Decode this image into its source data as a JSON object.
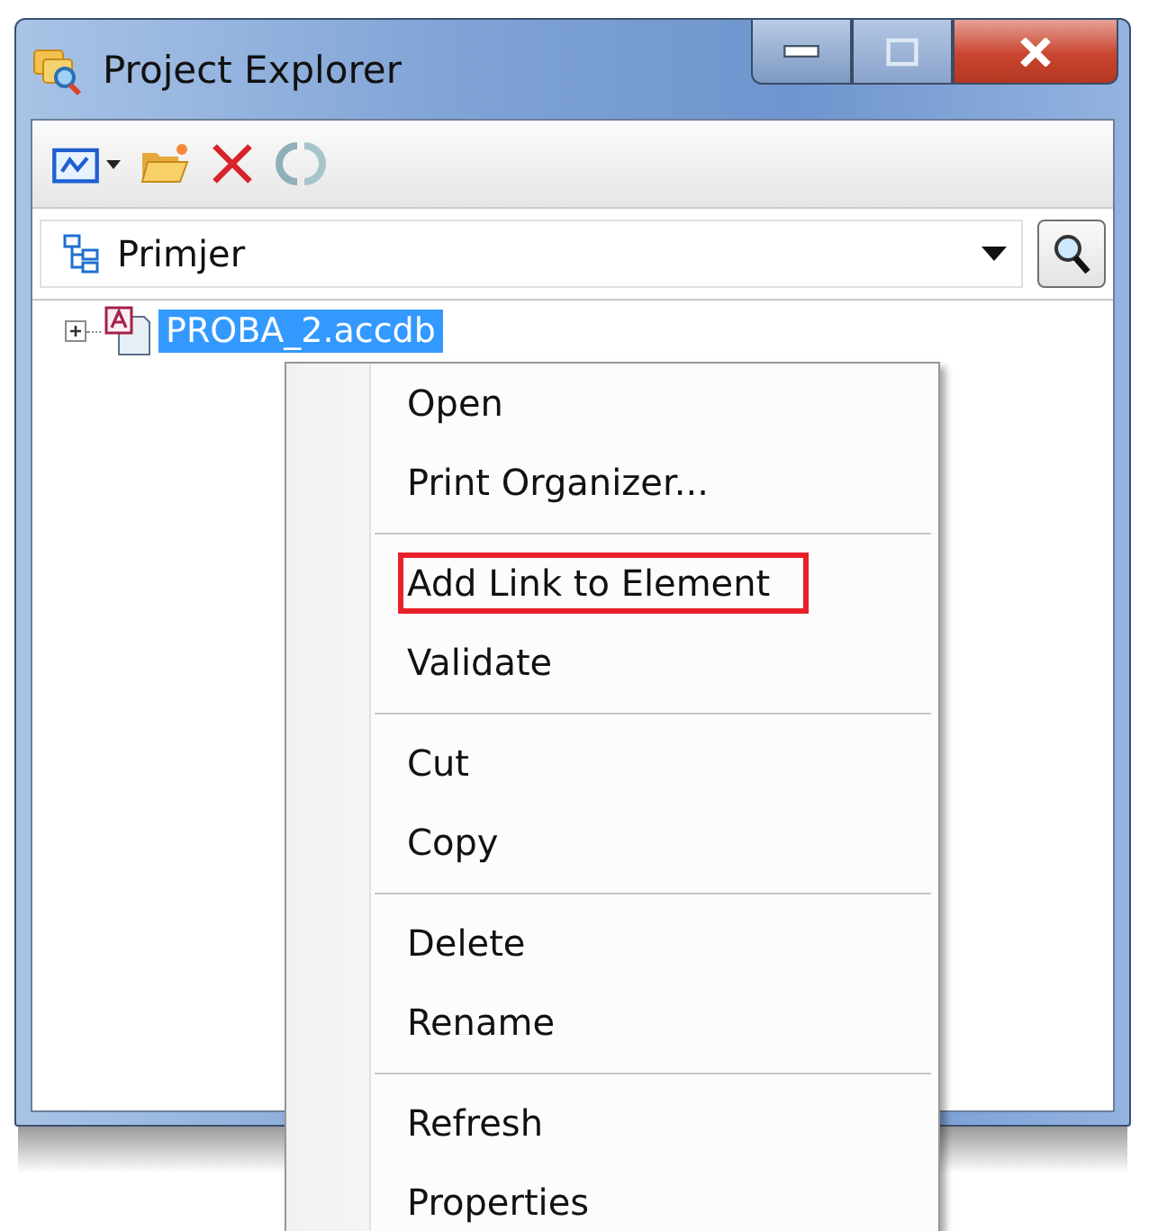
{
  "window": {
    "title": "Project Explorer"
  },
  "view_selector": {
    "value": "Primjer"
  },
  "tree": [
    {
      "label": "PROBA_2.accdb",
      "selected": true,
      "expanded": false
    }
  ],
  "context_menu": {
    "items": [
      {
        "kind": "item",
        "label": "Open",
        "highlighted": false
      },
      {
        "kind": "item",
        "label": "Print Organizer...",
        "highlighted": false
      },
      {
        "kind": "separator"
      },
      {
        "kind": "item",
        "label": "Add Link to Element",
        "highlighted": true
      },
      {
        "kind": "item",
        "label": "Validate",
        "highlighted": false
      },
      {
        "kind": "separator"
      },
      {
        "kind": "item",
        "label": "Cut",
        "highlighted": false
      },
      {
        "kind": "item",
        "label": "Copy",
        "highlighted": false
      },
      {
        "kind": "separator"
      },
      {
        "kind": "item",
        "label": "Delete",
        "highlighted": false
      },
      {
        "kind": "item",
        "label": "Rename",
        "highlighted": false
      },
      {
        "kind": "separator"
      },
      {
        "kind": "item",
        "label": "Refresh",
        "highlighted": false
      },
      {
        "kind": "item",
        "label": "Properties",
        "highlighted": false
      }
    ]
  }
}
